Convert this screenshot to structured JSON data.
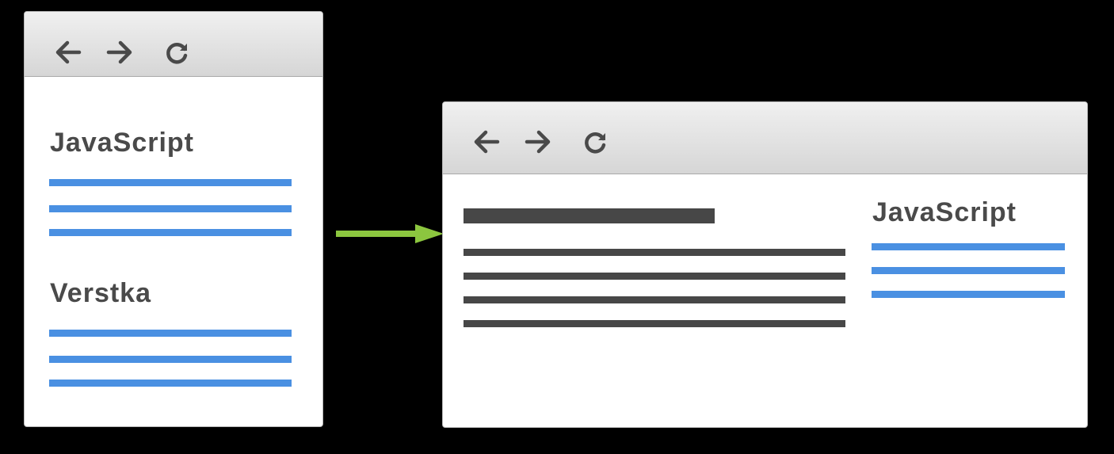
{
  "left_window": {
    "sections": [
      {
        "heading": "JavaScript"
      },
      {
        "heading": "Verstka"
      }
    ]
  },
  "right_window": {
    "sidebar": {
      "heading": "JavaScript"
    }
  },
  "colors": {
    "background": "#000000",
    "toolbar": "#dcdcdc",
    "text": "#4a4a4a",
    "blue_line": "#4a90e2",
    "dark_line": "#474747",
    "arrow": "#8cc63f"
  },
  "icons": [
    "back-arrow-icon",
    "forward-arrow-icon",
    "reload-icon"
  ]
}
